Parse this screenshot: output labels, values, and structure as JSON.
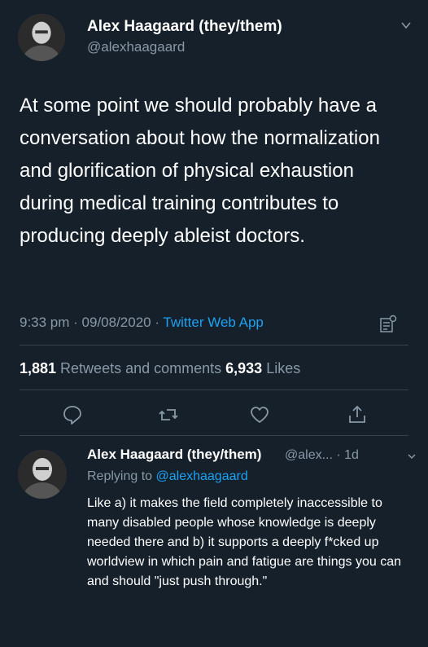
{
  "tweet": {
    "author_name": "Alex Haagaard (they/them)",
    "author_handle": "@alexhaagaard",
    "text": "At some point we should probably have a conversation about how the normalization and glorification of physical exhaustion during medical training contributes to producing deeply ableist doctors.",
    "time": "9:33 pm · 09/08/2020 · ",
    "app": "Twitter Web App",
    "retweets_count": "1,881",
    "retweets_label": " Retweets and comments ",
    "likes_count": "6,933",
    "likes_label": " Likes"
  },
  "icons": {
    "avatar": "profile-photo",
    "chevron": "chevron-down-icon",
    "analytics": "analytics-icon",
    "reply": "reply-icon",
    "retweet": "retweet-icon",
    "like": "heart-icon",
    "share": "share-icon"
  },
  "reply": {
    "author_name": "Alex Haagaard (they/them)",
    "handle_and_time": "@alex... · 1d",
    "replying_prefix": "Replying to ",
    "replying_to": "@alexhaagaard",
    "text": "Like a) it makes the field completely inaccessible to many disabled people whose knowledge is deeply needed there and b) it supports a deeply f*cked up worldview in which pain and fatigue are things you can and should \"just push through.\""
  },
  "colors": {
    "background": "#15202b",
    "secondary_text": "#8899a6",
    "accent": "#1da1f2",
    "divider": "#38444d"
  }
}
